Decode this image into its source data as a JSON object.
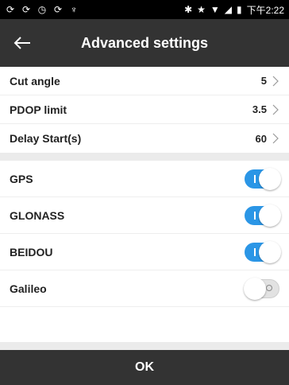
{
  "statusbar": {
    "time": "下午2:22",
    "left_icons": [
      "sync-icon",
      "sync-icon",
      "clock-icon",
      "sync-icon",
      "usb-icon"
    ],
    "right_icons": [
      "bluetooth-icon",
      "star-icon",
      "signal-icon",
      "wifi-icon",
      "battery-icon"
    ]
  },
  "appbar": {
    "title": "Advanced settings",
    "back_icon": "back-arrow-icon"
  },
  "settings": [
    {
      "label": "Cut angle",
      "value": "5"
    },
    {
      "label": "PDOP limit",
      "value": "3.5"
    },
    {
      "label": "Delay Start(s)",
      "value": "60"
    }
  ],
  "systems": [
    {
      "label": "GPS",
      "enabled": true
    },
    {
      "label": "GLONASS",
      "enabled": true
    },
    {
      "label": "BEIDOU",
      "enabled": true
    },
    {
      "label": "Galileo",
      "enabled": false
    }
  ],
  "footer": {
    "ok_label": "OK"
  },
  "colors": {
    "appbar": "#333333",
    "toggle_on": "#2b96e6",
    "background": "#ebebeb"
  }
}
